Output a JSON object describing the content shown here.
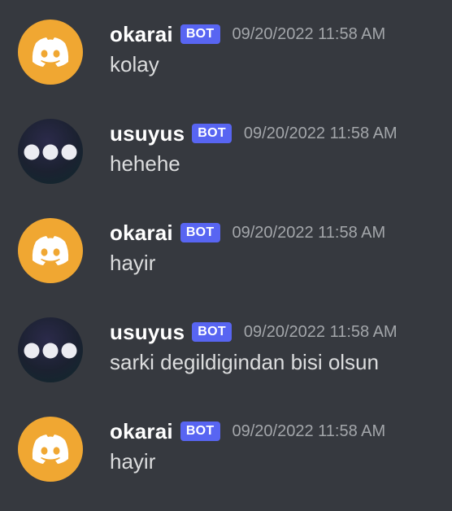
{
  "colors": {
    "background": "#36393f",
    "bot_tag": "#5865f2",
    "discord_avatar": "#f0a732",
    "username": "#ffffff",
    "timestamp": "#a3a6aa",
    "message_text": "#dcddde"
  },
  "messages": [
    {
      "author": "okarai",
      "tag": "BOT",
      "timestamp": "09/20/2022 11:58 AM",
      "text": "kolay",
      "avatar_icon": "discord-logo-icon"
    },
    {
      "author": "usuyus",
      "tag": "BOT",
      "timestamp": "09/20/2022 11:58 AM",
      "text": "hehehe",
      "avatar_icon": "three-dots-icon"
    },
    {
      "author": "okarai",
      "tag": "BOT",
      "timestamp": "09/20/2022 11:58 AM",
      "text": "hayir",
      "avatar_icon": "discord-logo-icon"
    },
    {
      "author": "usuyus",
      "tag": "BOT",
      "timestamp": "09/20/2022 11:58 AM",
      "text": "sarki degildigindan bisi olsun",
      "avatar_icon": "three-dots-icon"
    },
    {
      "author": "okarai",
      "tag": "BOT",
      "timestamp": "09/20/2022 11:58 AM",
      "text": "hayir",
      "avatar_icon": "discord-logo-icon"
    }
  ]
}
